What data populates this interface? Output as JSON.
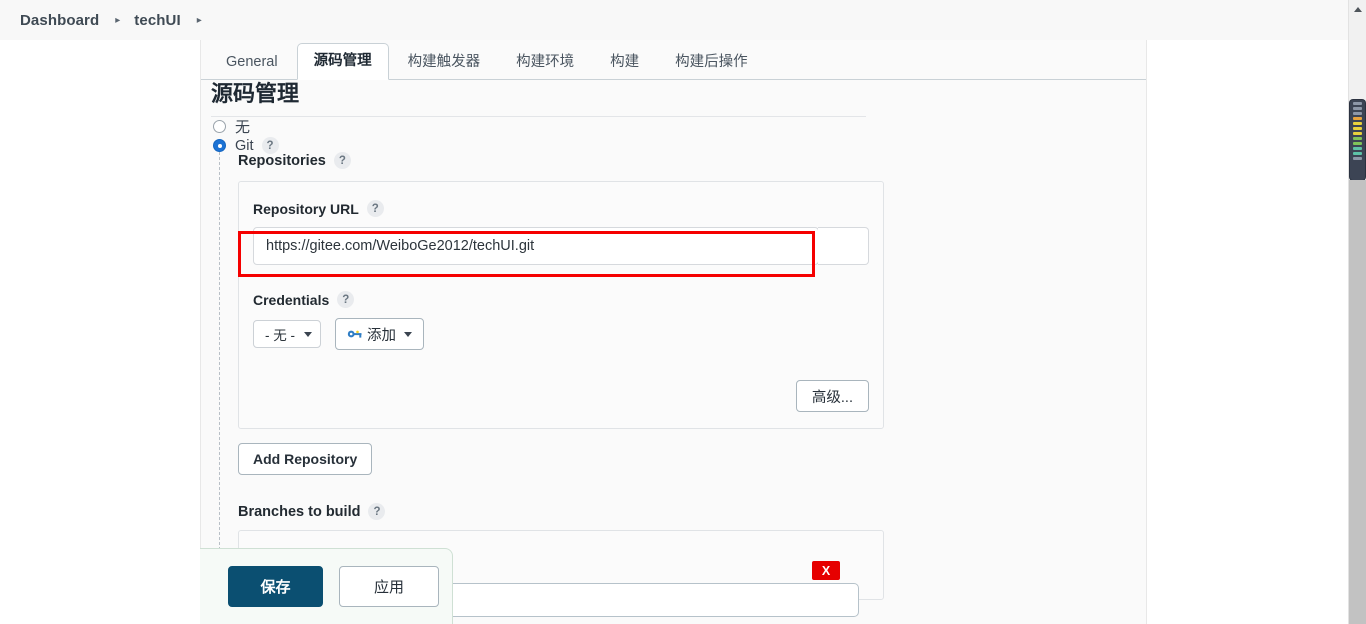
{
  "breadcrumb": {
    "items": [
      {
        "label": "Dashboard"
      },
      {
        "label": "techUI"
      }
    ],
    "separator": "▸",
    "trailing_separator": "▸"
  },
  "tabs": [
    {
      "label": "General",
      "active": false
    },
    {
      "label": "源码管理",
      "active": true
    },
    {
      "label": "构建触发器",
      "active": false
    },
    {
      "label": "构建环境",
      "active": false
    },
    {
      "label": "构建",
      "active": false
    },
    {
      "label": "构建后操作",
      "active": false
    }
  ],
  "section": {
    "title": "源码管理"
  },
  "scm": {
    "options": [
      {
        "label": "无",
        "selected": false
      },
      {
        "label": "Git",
        "selected": true
      }
    ],
    "git_help": "?"
  },
  "repositories": {
    "label": "Repositories",
    "help": "?",
    "repository_url": {
      "label": "Repository URL",
      "help": "?",
      "value": "https://gitee.com/WeiboGe2012/techUI.git",
      "placeholder": ""
    },
    "credentials": {
      "label": "Credentials",
      "help": "?",
      "selected": "- 无 -",
      "add_button": "添加",
      "add_icon": "key-icon"
    },
    "advanced_button": "高级...",
    "add_repository_button": "Add Repository"
  },
  "branches": {
    "label": "Branches to build",
    "help": "?"
  },
  "annotations": {
    "x_badge": "X",
    "highlight_color": "#f50000",
    "badge_color": "#e60000"
  },
  "footer": {
    "save_label": "保存",
    "apply_label": "应用",
    "save_color": "#0b4f71"
  },
  "scrollbar": {
    "up_arrow": "▲",
    "stripes": [
      "#8d97a8",
      "#8d97a8",
      "#8d97a8",
      "#e8a33d",
      "#e8d23d",
      "#e8d23d",
      "#e8d23d",
      "#7fc45a",
      "#7fc45a",
      "#5ec2a8",
      "#5ec2a8",
      "#8d97a8"
    ]
  }
}
